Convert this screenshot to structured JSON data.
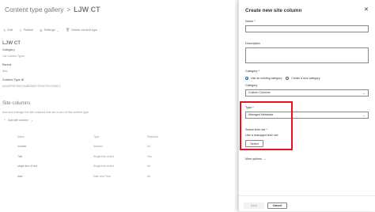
{
  "breadcrumb": {
    "parent": "Content type gallery",
    "separator": ">",
    "current": "LJW CT"
  },
  "toolbar": {
    "edit": "Edit",
    "publish": "Publish",
    "settings": "Settings",
    "delete": "Delete content type",
    "icons": [
      "pencil-icon",
      "publish-icon",
      "gear-icon",
      "delete-icon"
    ]
  },
  "content_type": {
    "title": "LJW CT",
    "category_label": "Category",
    "category_value": "List Content Types",
    "parent_label": "Parent",
    "parent_value": "Item",
    "id_label": "Content Type ID",
    "id_value": "0x0100F8F2E5C0A88D9DE17DFA74F47AD5D2"
  },
  "site_columns": {
    "title": "Site columns",
    "description": "Add and manage the site columns that are a part of this content type.",
    "add_label": "Add site column",
    "headers": [
      "Name",
      "Type",
      "Required"
    ],
    "rows": [
      [
        "number",
        "Number",
        "No"
      ],
      [
        "Title",
        "Single line of text",
        "Yes"
      ],
      [
        "single line of text",
        "Single line of text",
        "No"
      ],
      [
        "date",
        "Date and Time",
        "No"
      ]
    ]
  },
  "panel": {
    "title": "Create new site column",
    "close_icon": "close-icon",
    "name_label": "Name *",
    "name_value": "",
    "description_label": "Description",
    "description_value": "",
    "category_label": "Category *",
    "radio_existing": "Use an existing category",
    "radio_new": "Create a new category",
    "category_sub_label": "Category",
    "category_value": "Custom Columns",
    "type_label": "Type *",
    "type_value": "Managed Metadata",
    "term_set_label": "Select term set *",
    "term_set_hint": "Use a managed term set",
    "select_button": "Select",
    "more_options": "More options",
    "save_button": "Save",
    "cancel_button": "Cancel"
  },
  "colors": {
    "highlight": "#e81123",
    "accent": "#0f6cbd"
  }
}
